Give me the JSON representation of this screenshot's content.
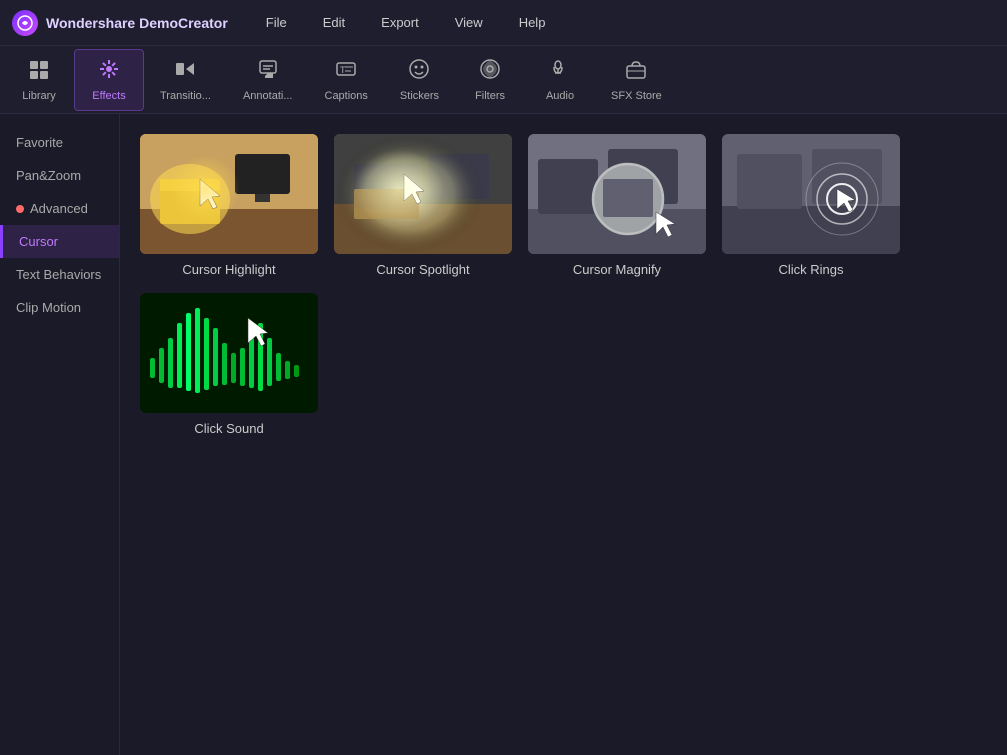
{
  "app": {
    "logo": "C",
    "name": "Wondershare DemoCreator"
  },
  "menu": {
    "items": [
      "File",
      "Edit",
      "Export",
      "View",
      "Help"
    ]
  },
  "toolbar": {
    "items": [
      {
        "id": "library",
        "label": "Library",
        "icon": "⊞",
        "active": false
      },
      {
        "id": "effects",
        "label": "Effects",
        "icon": "✨",
        "active": true
      },
      {
        "id": "transitions",
        "label": "Transitio...",
        "icon": "⏭",
        "active": false
      },
      {
        "id": "annotations",
        "label": "Annotati...",
        "icon": "🗨",
        "active": false
      },
      {
        "id": "captions",
        "label": "Captions",
        "icon": "T",
        "active": false
      },
      {
        "id": "stickers",
        "label": "Stickers",
        "icon": "☺",
        "active": false
      },
      {
        "id": "filters",
        "label": "Filters",
        "icon": "⊕",
        "active": false
      },
      {
        "id": "audio",
        "label": "Audio",
        "icon": "♪",
        "active": false
      },
      {
        "id": "sfx-store",
        "label": "SFX Store",
        "icon": "🛍",
        "active": false
      }
    ]
  },
  "sidebar": {
    "items": [
      {
        "id": "favorite",
        "label": "Favorite",
        "hasDot": false
      },
      {
        "id": "pan-zoom",
        "label": "Pan&Zoom",
        "hasDot": false
      },
      {
        "id": "advanced",
        "label": "Advanced",
        "hasDot": true
      },
      {
        "id": "cursor",
        "label": "Cursor",
        "hasDot": false,
        "active": true
      },
      {
        "id": "text-behaviors",
        "label": "Text Behaviors",
        "hasDot": false
      },
      {
        "id": "clip-motion",
        "label": "Clip Motion",
        "hasDot": false
      }
    ]
  },
  "effects": {
    "items": [
      {
        "id": "cursor-highlight",
        "label": "Cursor Highlight"
      },
      {
        "id": "cursor-spotlight",
        "label": "Cursor Spotlight"
      },
      {
        "id": "cursor-magnify",
        "label": "Cursor Magnify"
      },
      {
        "id": "click-rings",
        "label": "Click Rings"
      },
      {
        "id": "click-sound",
        "label": "Click Sound"
      }
    ]
  },
  "colors": {
    "accent": "#8b3fff",
    "active_bg": "#2e2246",
    "active_border": "#5a3a8a",
    "active_text": "#c07aff",
    "bg_dark": "#1a1a28",
    "bg_medium": "#1e1e2e",
    "border": "#2a2a3e",
    "text_primary": "#cccccc",
    "text_dim": "#aaaaaa",
    "green_wave": "#00cc44"
  }
}
